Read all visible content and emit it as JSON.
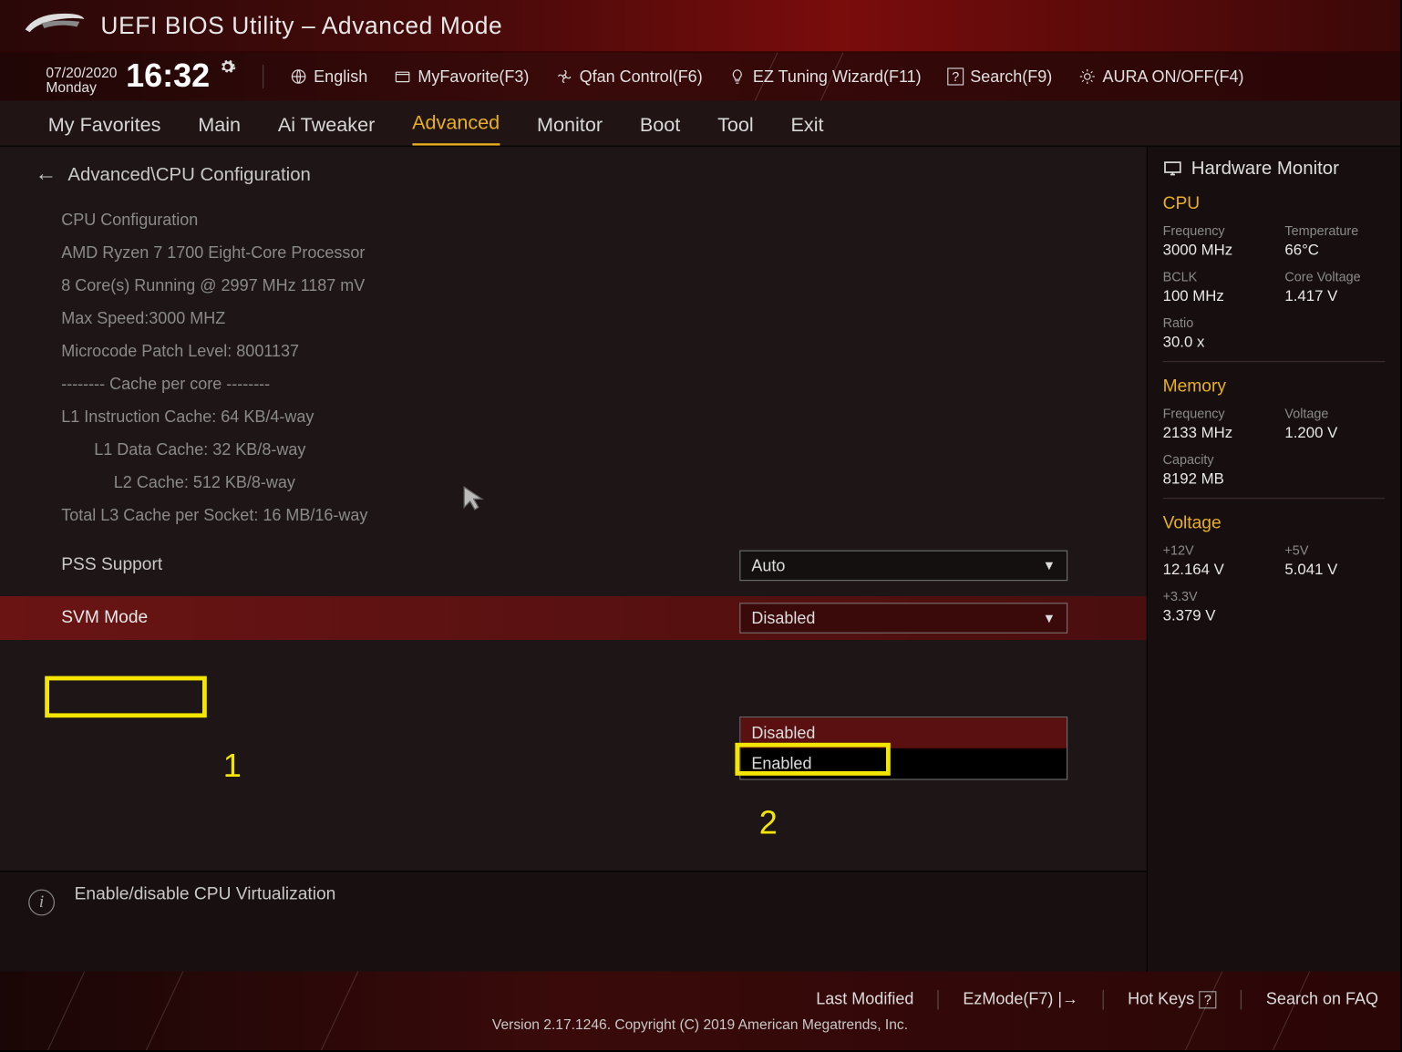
{
  "header": {
    "title": "UEFI BIOS Utility",
    "mode": "Advanced Mode"
  },
  "datetime": {
    "date": "07/20/2020",
    "day": "Monday",
    "time": "16:32"
  },
  "toolbar": {
    "language": "English",
    "myfavorite": "MyFavorite(F3)",
    "qfan": "Qfan Control(F6)",
    "tuning": "EZ Tuning Wizard(F11)",
    "search": "Search(F9)",
    "aura": "AURA ON/OFF(F4)"
  },
  "tabs": [
    "My Favorites",
    "Main",
    "Ai Tweaker",
    "Advanced",
    "Monitor",
    "Boot",
    "Tool",
    "Exit"
  ],
  "active_tab": "Advanced",
  "breadcrumb": "Advanced\\CPU Configuration",
  "cpu_info": [
    "CPU Configuration",
    "AMD Ryzen 7 1700 Eight-Core Processor",
    "8 Core(s) Running @ 2997 MHz  1187 mV",
    "Max Speed:3000 MHZ",
    "Microcode Patch Level: 8001137",
    "-------- Cache per core --------",
    "L1 Instruction Cache: 64 KB/4-way",
    "L1 Data Cache: 32 KB/8-way",
    "L2 Cache: 512 KB/8-way",
    "Total L3 Cache per Socket: 16 MB/16-way"
  ],
  "settings": {
    "pss": {
      "label": "PSS Support",
      "value": "Auto"
    },
    "svm": {
      "label": "SVM Mode",
      "value": "Disabled",
      "options": [
        "Disabled",
        "Enabled"
      ]
    }
  },
  "help_text": "Enable/disable CPU Virtualization",
  "annotations": {
    "num1": "1",
    "num2": "2"
  },
  "sidebar": {
    "title": "Hardware Monitor",
    "cpu": {
      "heading": "CPU",
      "freq_k": "Frequency",
      "freq_v": "3000 MHz",
      "temp_k": "Temperature",
      "temp_v": "66°C",
      "bclk_k": "BCLK",
      "bclk_v": "100 MHz",
      "corev_k": "Core Voltage",
      "corev_v": "1.417 V",
      "ratio_k": "Ratio",
      "ratio_v": "30.0 x"
    },
    "memory": {
      "heading": "Memory",
      "freq_k": "Frequency",
      "freq_v": "2133 MHz",
      "volt_k": "Voltage",
      "volt_v": "1.200 V",
      "cap_k": "Capacity",
      "cap_v": "8192 MB"
    },
    "voltage": {
      "heading": "Voltage",
      "v12_k": "+12V",
      "v12_v": "12.164 V",
      "v5_k": "+5V",
      "v5_v": "5.041 V",
      "v33_k": "+3.3V",
      "v33_v": "3.379 V"
    }
  },
  "footer": {
    "last_modified": "Last Modified",
    "ezmode": "EzMode(F7)",
    "hotkeys": "Hot Keys",
    "searchfaq": "Search on FAQ",
    "copyright": "Version 2.17.1246. Copyright (C) 2019 American Megatrends, Inc."
  }
}
